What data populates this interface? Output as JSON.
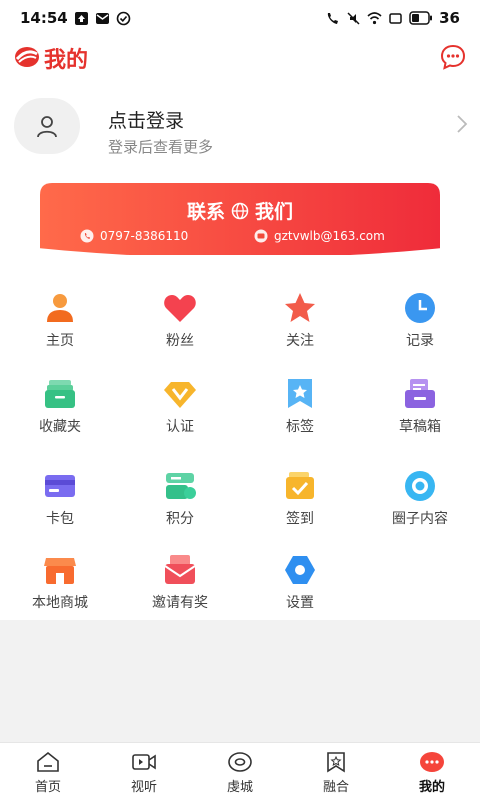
{
  "status": {
    "time": "14:54",
    "battery": "36"
  },
  "header": {
    "title": "我的"
  },
  "login": {
    "title": "点击登录",
    "subtitle": "登录后查看更多"
  },
  "contact": {
    "title_left": "联系",
    "title_right": "我们",
    "phone": "0797-8386110",
    "email": "gztvwlb@163.com"
  },
  "grid": [
    {
      "label": "主页",
      "icon": "person-icon"
    },
    {
      "label": "粉丝",
      "icon": "heart-icon"
    },
    {
      "label": "关注",
      "icon": "star-icon"
    },
    {
      "label": "记录",
      "icon": "clock-icon"
    },
    {
      "label": "收藏夹",
      "icon": "folder-icon"
    },
    {
      "label": "认证",
      "icon": "diamond-v-icon"
    },
    {
      "label": "标签",
      "icon": "tag-icon"
    },
    {
      "label": "草稿箱",
      "icon": "draft-icon"
    },
    {
      "label": "卡包",
      "icon": "card-icon"
    },
    {
      "label": "积分",
      "icon": "points-icon"
    },
    {
      "label": "签到",
      "icon": "checkin-icon"
    },
    {
      "label": "圈子内容",
      "icon": "circle-icon"
    },
    {
      "label": "本地商城",
      "icon": "shop-icon"
    },
    {
      "label": "邀请有奖",
      "icon": "envelope-icon"
    },
    {
      "label": "设置",
      "icon": "settings-icon"
    }
  ],
  "tabs": [
    {
      "label": "首页",
      "icon": "home-icon"
    },
    {
      "label": "视听",
      "icon": "video-icon"
    },
    {
      "label": "虔城",
      "icon": "eye-icon"
    },
    {
      "label": "融合",
      "icon": "bookmark-star-icon"
    },
    {
      "label": "我的",
      "icon": "me-icon"
    }
  ],
  "colors": {
    "brand": "#e5322d",
    "accent": "#f5453b"
  }
}
